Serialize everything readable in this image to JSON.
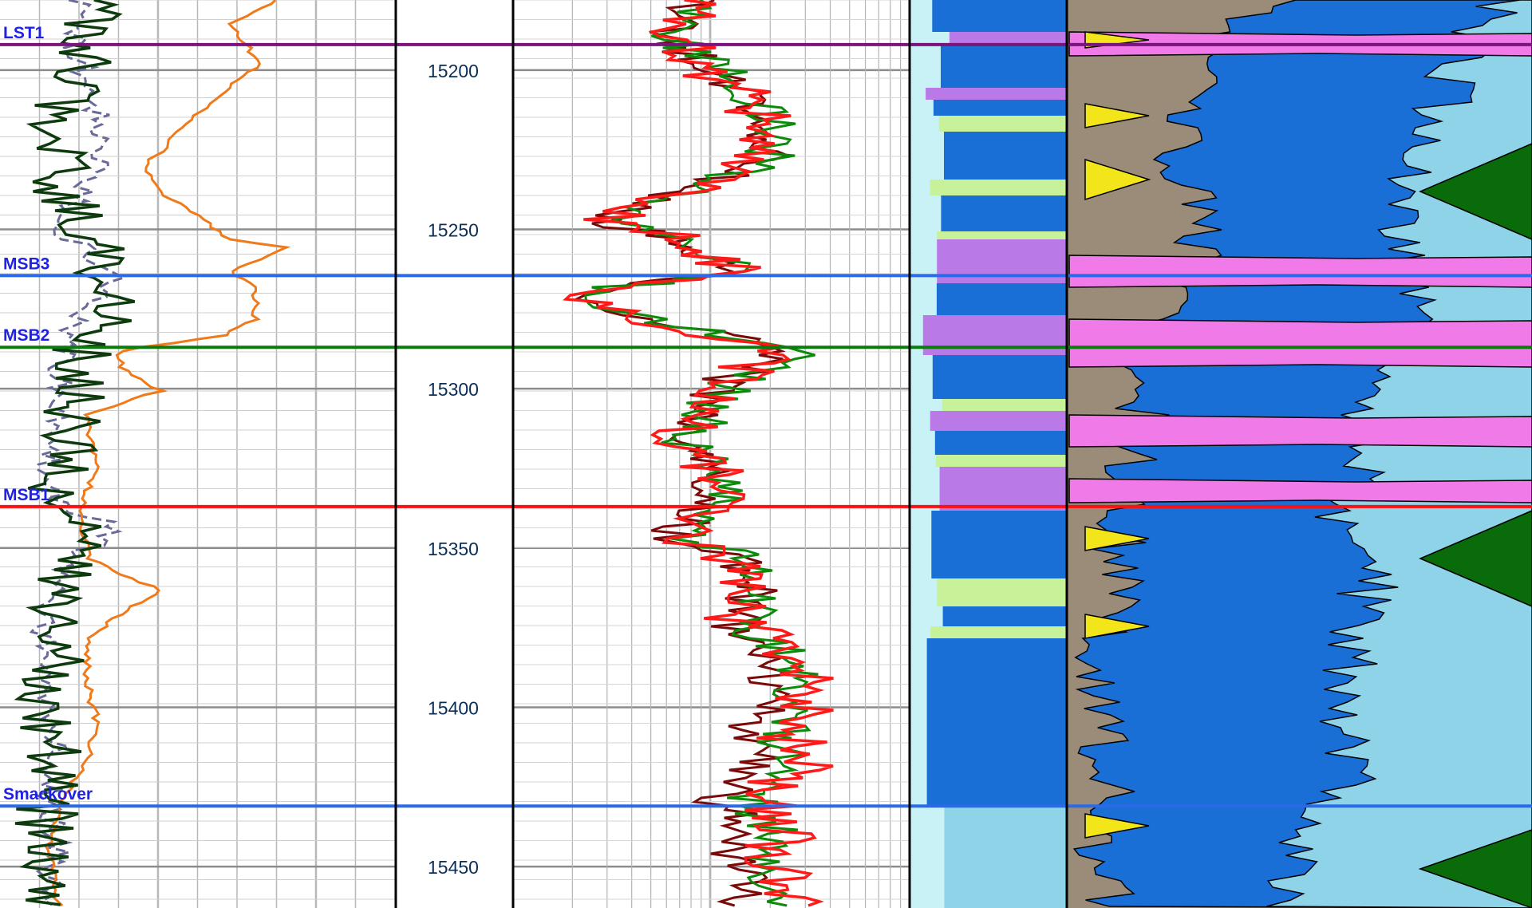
{
  "colors": {
    "gamma_ray_dark": "#0e3b0e",
    "gamma_ray_dashed": "#6a6a99",
    "orange_curve": "#f07a1a",
    "resistivity_red": "#ff1a1a",
    "resistivity_green": "#0b8a0b",
    "resistivity_maroon": "#7a0a0a",
    "limestone_blue": "#1a6fd6",
    "dolomite_light_blue": "#8fd3e8",
    "anhydrite_pink": "#f07ae8",
    "shale_grey": "#9a8c78",
    "sand_yellow": "#f2e61a",
    "green_fill": "#0a6b0a",
    "salt_purple": "#b97ae8",
    "sandy_green": "#c8f29a",
    "pale_cyan": "#c9f2f7"
  },
  "chart_data": {
    "type": "line",
    "title": "",
    "ylabel": "",
    "xlabel": "",
    "depth_range": [
      15178,
      15463
    ],
    "depth_ticks": [
      "15200",
      "15250",
      "15300",
      "15350",
      "15400",
      "15450"
    ],
    "depth_tick_values": [
      15200,
      15250,
      15300,
      15350,
      15400,
      15450
    ],
    "formation_tops": [
      {
        "label": "LST1",
        "depth": 15192,
        "color": "#7a137a"
      },
      {
        "label": "MSB3",
        "depth": 15264.5,
        "color": "#2a6ae8"
      },
      {
        "label": "MSB2",
        "depth": 15287,
        "color": "#0d7a0d"
      },
      {
        "label": "MSB1",
        "depth": 15337,
        "color": "#ff1010"
      },
      {
        "label": "Smackover",
        "depth": 15431,
        "color": "#2a6ae8"
      }
    ],
    "icons": {
      "tracks": [
        "gamma-ray-track",
        "depth-track",
        "resistivity-track",
        "lithology-column-track",
        "mineral-fraction-track"
      ]
    }
  }
}
